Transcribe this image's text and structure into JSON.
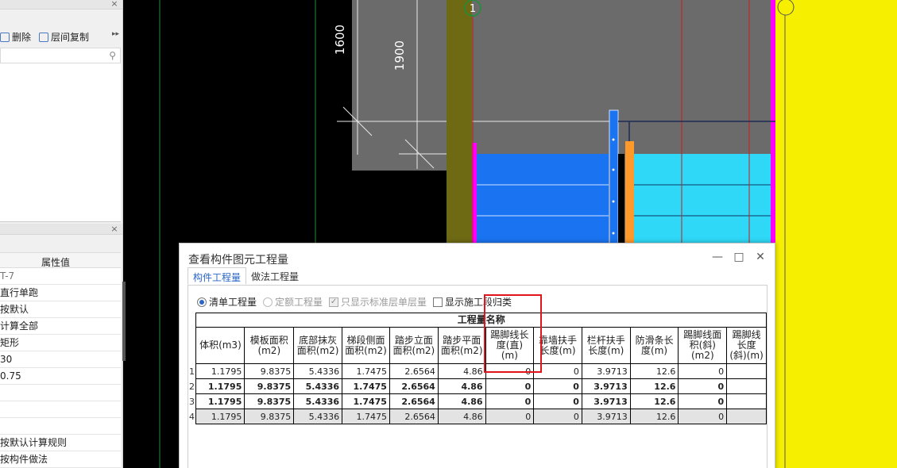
{
  "left_panel": {
    "toolbar": {
      "delete_label": "删除",
      "copy_floor_label": "层间复制",
      "more": "▸▸"
    },
    "close_glyph": "×",
    "properties": {
      "header_value": "属性值",
      "rows": [
        "T-7",
        "直行单跑",
        "按默认",
        "计算全部",
        "矩形",
        "30",
        "0.75",
        "",
        "",
        "",
        "按默认计算规则",
        "按构件做法"
      ]
    }
  },
  "canvas": {
    "dim_1600": "1600",
    "dim_1900": "1900",
    "axis_label": "1"
  },
  "dialog": {
    "title": "查看构件图元工程量",
    "window_buttons": {
      "minimize": "—",
      "maximize": "□",
      "close": "✕"
    },
    "tabs": [
      "构件工程量",
      "做法工程量"
    ],
    "options": {
      "list_qty": "清单工程量",
      "quota_qty": "定额工程量",
      "std_floor_only": "只显示标准层单层量",
      "show_segment": "显示施工段归类"
    },
    "table": {
      "group_header": "工程量名称",
      "columns": [
        "体积(m3)",
        "模板面积(m2)",
        "底部抹灰面积(m2)",
        "梯段侧面面积(m2)",
        "踏步立面面积(m2)",
        "踏步平面面积(m2)",
        "踢脚线长度(直)(m)",
        "靠墙扶手长度(m)",
        "栏杆扶手长度(m)",
        "防滑条长度(m)",
        "踢脚线面积(斜)(m2)",
        "踢脚线长度(斜)(m)"
      ],
      "rows": [
        {
          "index": "1",
          "values": [
            "1.1795",
            "9.8375",
            "5.4336",
            "1.7475",
            "2.6564",
            "4.86",
            "0",
            "0",
            "3.9713",
            "12.6",
            "0",
            ""
          ]
        },
        {
          "index": "2",
          "values": [
            "1.1795",
            "9.8375",
            "5.4336",
            "1.7475",
            "2.6564",
            "4.86",
            "0",
            "0",
            "3.9713",
            "12.6",
            "0",
            ""
          ]
        },
        {
          "index": "3",
          "values": [
            "1.1795",
            "9.8375",
            "5.4336",
            "1.7475",
            "2.6564",
            "4.86",
            "0",
            "0",
            "3.9713",
            "12.6",
            "0",
            ""
          ]
        },
        {
          "index": "4",
          "values": [
            "1.1795",
            "9.8375",
            "5.4336",
            "1.7475",
            "2.6564",
            "4.86",
            "0",
            "0",
            "3.9713",
            "12.6",
            "0",
            ""
          ]
        }
      ]
    }
  },
  "colors": {
    "accent": "#2a66c7",
    "highlight_box": "#e0141a",
    "stair_blue": "#1a73f0",
    "stair_cyan": "#2fd8f7",
    "magenta": "#ff00ff",
    "yellow": "#f6f000",
    "olive": "#6e6a14"
  }
}
